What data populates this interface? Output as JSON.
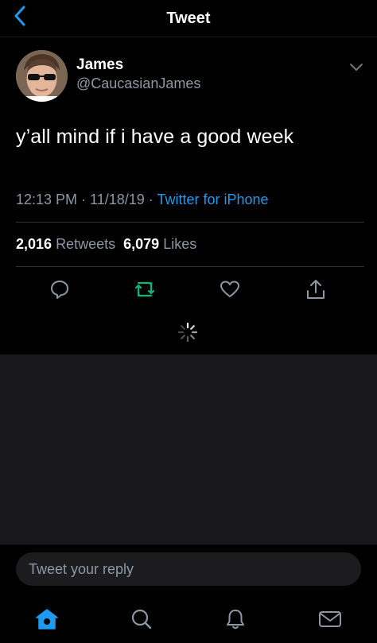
{
  "header": {
    "title": "Tweet"
  },
  "tweet": {
    "display_name": "James",
    "handle": "@CaucasianJames",
    "text": "y’all mind if i have a good week",
    "time": "12:13 PM",
    "separator": " · ",
    "date": "11/18/19",
    "source": "Twitter for iPhone",
    "retweets_count": "2,016",
    "retweets_label": "Retweets",
    "likes_count": "6,079",
    "likes_label": "Likes"
  },
  "reply": {
    "placeholder": "Tweet your reply"
  },
  "icons": {
    "back": "chevron-left-icon",
    "more": "chevron-down-icon",
    "reply": "comment-icon",
    "retweet": "retweet-icon",
    "like": "heart-icon",
    "share": "share-icon",
    "home": "home-icon",
    "search": "search-icon",
    "notifications": "bell-icon",
    "messages": "mail-icon"
  },
  "colors": {
    "accent": "#1d9bf0",
    "retweet_active": "#00ba7c",
    "secondary_text": "#8b98a5",
    "background": "#000000"
  }
}
